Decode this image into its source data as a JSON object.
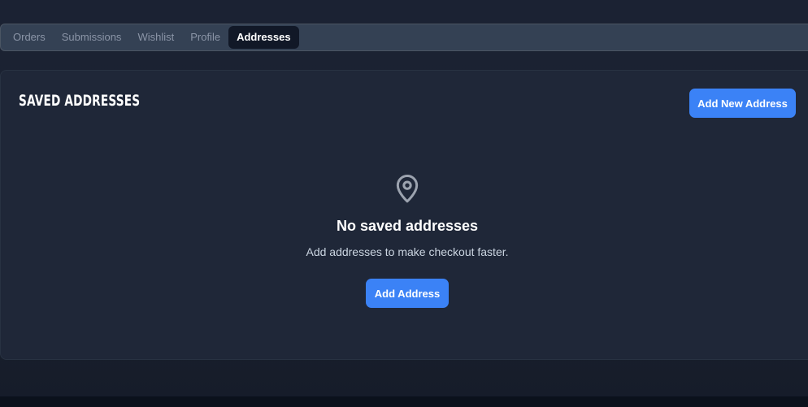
{
  "tabs": [
    {
      "label": "Orders",
      "active": false
    },
    {
      "label": "Submissions",
      "active": false
    },
    {
      "label": "Wishlist",
      "active": false
    },
    {
      "label": "Profile",
      "active": false
    },
    {
      "label": "Addresses",
      "active": true
    }
  ],
  "addresses": {
    "title": "SAVED ADDRESSES",
    "add_new_label": "Add New Address",
    "empty_state": {
      "icon": "map-pin-icon",
      "title": "No saved addresses",
      "description": "Add addresses to make checkout faster.",
      "button_label": "Add Address"
    }
  },
  "colors": {
    "accent": "#3b82f6",
    "background": "#1b2233",
    "card": "#1f2738",
    "tab_bar": "#344154",
    "active_tab": "#111827"
  }
}
